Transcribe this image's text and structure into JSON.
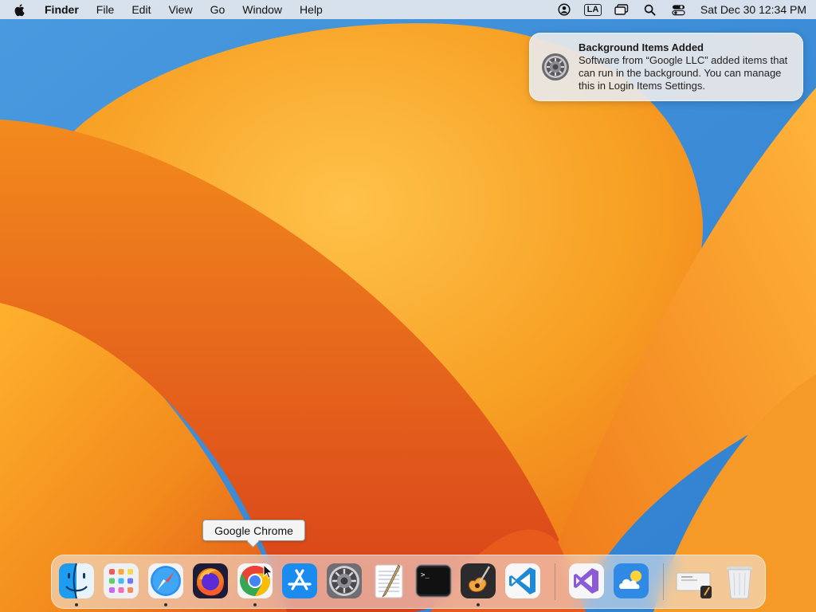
{
  "menubar": {
    "app_name": "Finder",
    "menus": [
      "File",
      "Edit",
      "View",
      "Go",
      "Window",
      "Help"
    ],
    "input_source": "LA",
    "clock": "Sat Dec 30  12:34 PM"
  },
  "notification": {
    "title": "Background Items Added",
    "body": "Software from “Google LLC” added items that can run in the background. You can manage this in Login Items Settings.",
    "icon": "system-settings-icon"
  },
  "tooltip": {
    "label": "Google Chrome"
  },
  "dock": {
    "items": [
      {
        "name": "finder",
        "running": true
      },
      {
        "name": "launchpad",
        "running": false
      },
      {
        "name": "safari",
        "running": true
      },
      {
        "name": "firefox",
        "running": false
      },
      {
        "name": "google-chrome",
        "running": true
      },
      {
        "name": "app-store",
        "running": false
      },
      {
        "name": "system-settings",
        "running": false
      },
      {
        "name": "textedit",
        "running": false
      },
      {
        "name": "terminal",
        "running": false
      },
      {
        "name": "garageband",
        "running": true
      },
      {
        "name": "visual-studio-code",
        "running": false
      },
      {
        "name": "visual-studio",
        "running": false
      },
      {
        "name": "weather",
        "running": false
      },
      {
        "name": "downloads-stack",
        "running": false
      },
      {
        "name": "trash",
        "running": false
      }
    ]
  },
  "colors": {
    "wallpaper_blue": "#3f8fd6",
    "wallpaper_orange": "#f39a1e",
    "wallpaper_red": "#d9461c"
  }
}
